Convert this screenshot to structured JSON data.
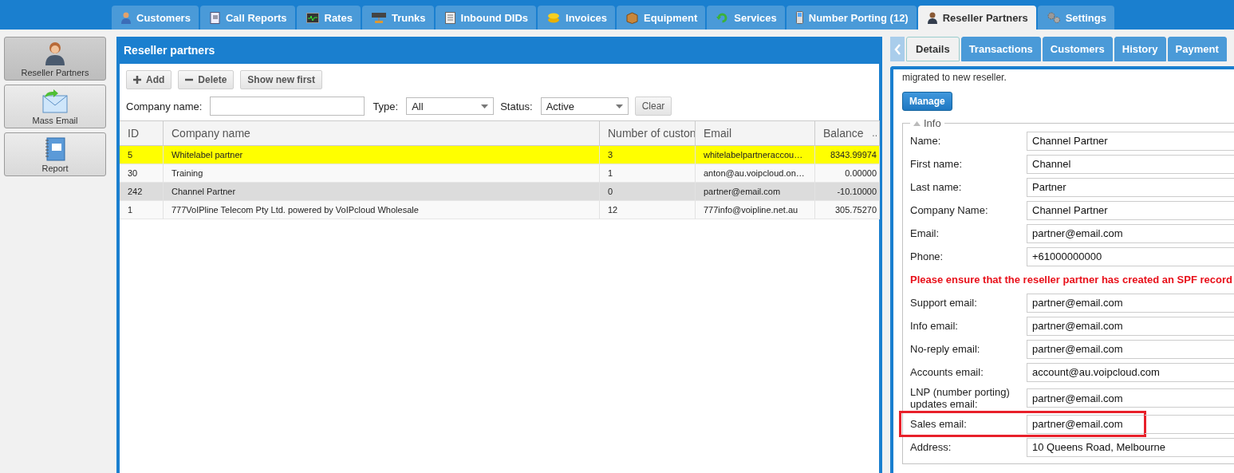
{
  "main_tabs": [
    {
      "label": "Customers",
      "selected": false
    },
    {
      "label": "Call Reports",
      "selected": false
    },
    {
      "label": "Rates",
      "selected": false
    },
    {
      "label": "Trunks",
      "selected": false
    },
    {
      "label": "Inbound DIDs",
      "selected": false
    },
    {
      "label": "Invoices",
      "selected": false
    },
    {
      "label": "Equipment",
      "selected": false
    },
    {
      "label": "Services",
      "selected": false
    },
    {
      "label": "Number Porting (12)",
      "selected": false
    },
    {
      "label": "Reseller Partners",
      "selected": true
    },
    {
      "label": "Settings",
      "selected": false
    }
  ],
  "sidebar": {
    "items": [
      {
        "label": "Reseller Partners",
        "selected": true
      },
      {
        "label": "Mass Email",
        "selected": false
      },
      {
        "label": "Report",
        "selected": false
      }
    ]
  },
  "list_panel": {
    "title": "Reseller partners",
    "toolbar": [
      {
        "label": "Add",
        "kind": "add"
      },
      {
        "label": "Delete",
        "kind": "delete"
      },
      {
        "label": "Show new first",
        "kind": "plain"
      }
    ],
    "filters": {
      "company_label": "Company name:",
      "type_label": "Type:",
      "type_value": "All",
      "status_label": "Status:",
      "status_value": "Active",
      "clear": "Clear"
    },
    "table": {
      "columns": [
        "ID",
        "Company name",
        "Number of custon",
        "Email",
        "Balance"
      ],
      "column_menu": "..",
      "rows": [
        {
          "cells": [
            "5",
            "Whitelabel partner",
            "3",
            "whitelabelpartneraccou…",
            "8343.99974"
          ],
          "selected": true,
          "highlighted": false
        },
        {
          "cells": [
            "30",
            "Training",
            "1",
            "anton@au.voipcloud.on…",
            "0.00000"
          ],
          "selected": false,
          "highlighted": false
        },
        {
          "cells": [
            "242",
            "Channel Partner",
            "0",
            "partner@email.com",
            "-10.10000"
          ],
          "selected": false,
          "highlighted": true
        },
        {
          "cells": [
            "1",
            "777VoIPline Telecom Pty Ltd. powered by VoIPcloud Wholesale",
            "12",
            "777info@voipline.net.au",
            "305.75270"
          ],
          "selected": false,
          "highlighted": false
        }
      ]
    }
  },
  "detail_panel": {
    "tabs": [
      {
        "label": "Details",
        "selected": true
      },
      {
        "label": "Transactions",
        "selected": false
      },
      {
        "label": "Customers",
        "selected": false
      },
      {
        "label": "History",
        "selected": false
      },
      {
        "label": "Payment",
        "selected": false
      }
    ],
    "intro": "migrated to new reseller.",
    "manage": "Manage",
    "section": "Info",
    "fields": [
      {
        "kind": "field",
        "label": "Name:",
        "value": "Channel Partner"
      },
      {
        "kind": "field",
        "label": "First name:",
        "value": "Channel"
      },
      {
        "kind": "field",
        "label": "Last name:",
        "value": "Partner"
      },
      {
        "kind": "field",
        "label": "Company Name:",
        "value": "Channel Partner"
      },
      {
        "kind": "field",
        "label": "Email:",
        "value": "partner@email.com"
      },
      {
        "kind": "field",
        "label": "Phone:",
        "value": "+61000000000"
      },
      {
        "kind": "notice",
        "label": "Please ensure that the reseller partner has created an SPF record"
      },
      {
        "kind": "field",
        "label": "Support email:",
        "value": "partner@email.com"
      },
      {
        "kind": "field",
        "label": "Info email:",
        "value": "partner@email.com"
      },
      {
        "kind": "field",
        "label": "No-reply email:",
        "value": "partner@email.com"
      },
      {
        "kind": "field",
        "label": "Accounts email:",
        "value": "account@au.voipcloud.com"
      },
      {
        "kind": "field",
        "label": "LNP (number porting) updates email:",
        "value": "partner@email.com"
      },
      {
        "kind": "field",
        "label": "Sales email:",
        "value": "partner@email.com",
        "highlighted": true
      },
      {
        "kind": "field",
        "label": "Address:",
        "value": "10 Queens Road, Melbourne"
      }
    ]
  }
}
